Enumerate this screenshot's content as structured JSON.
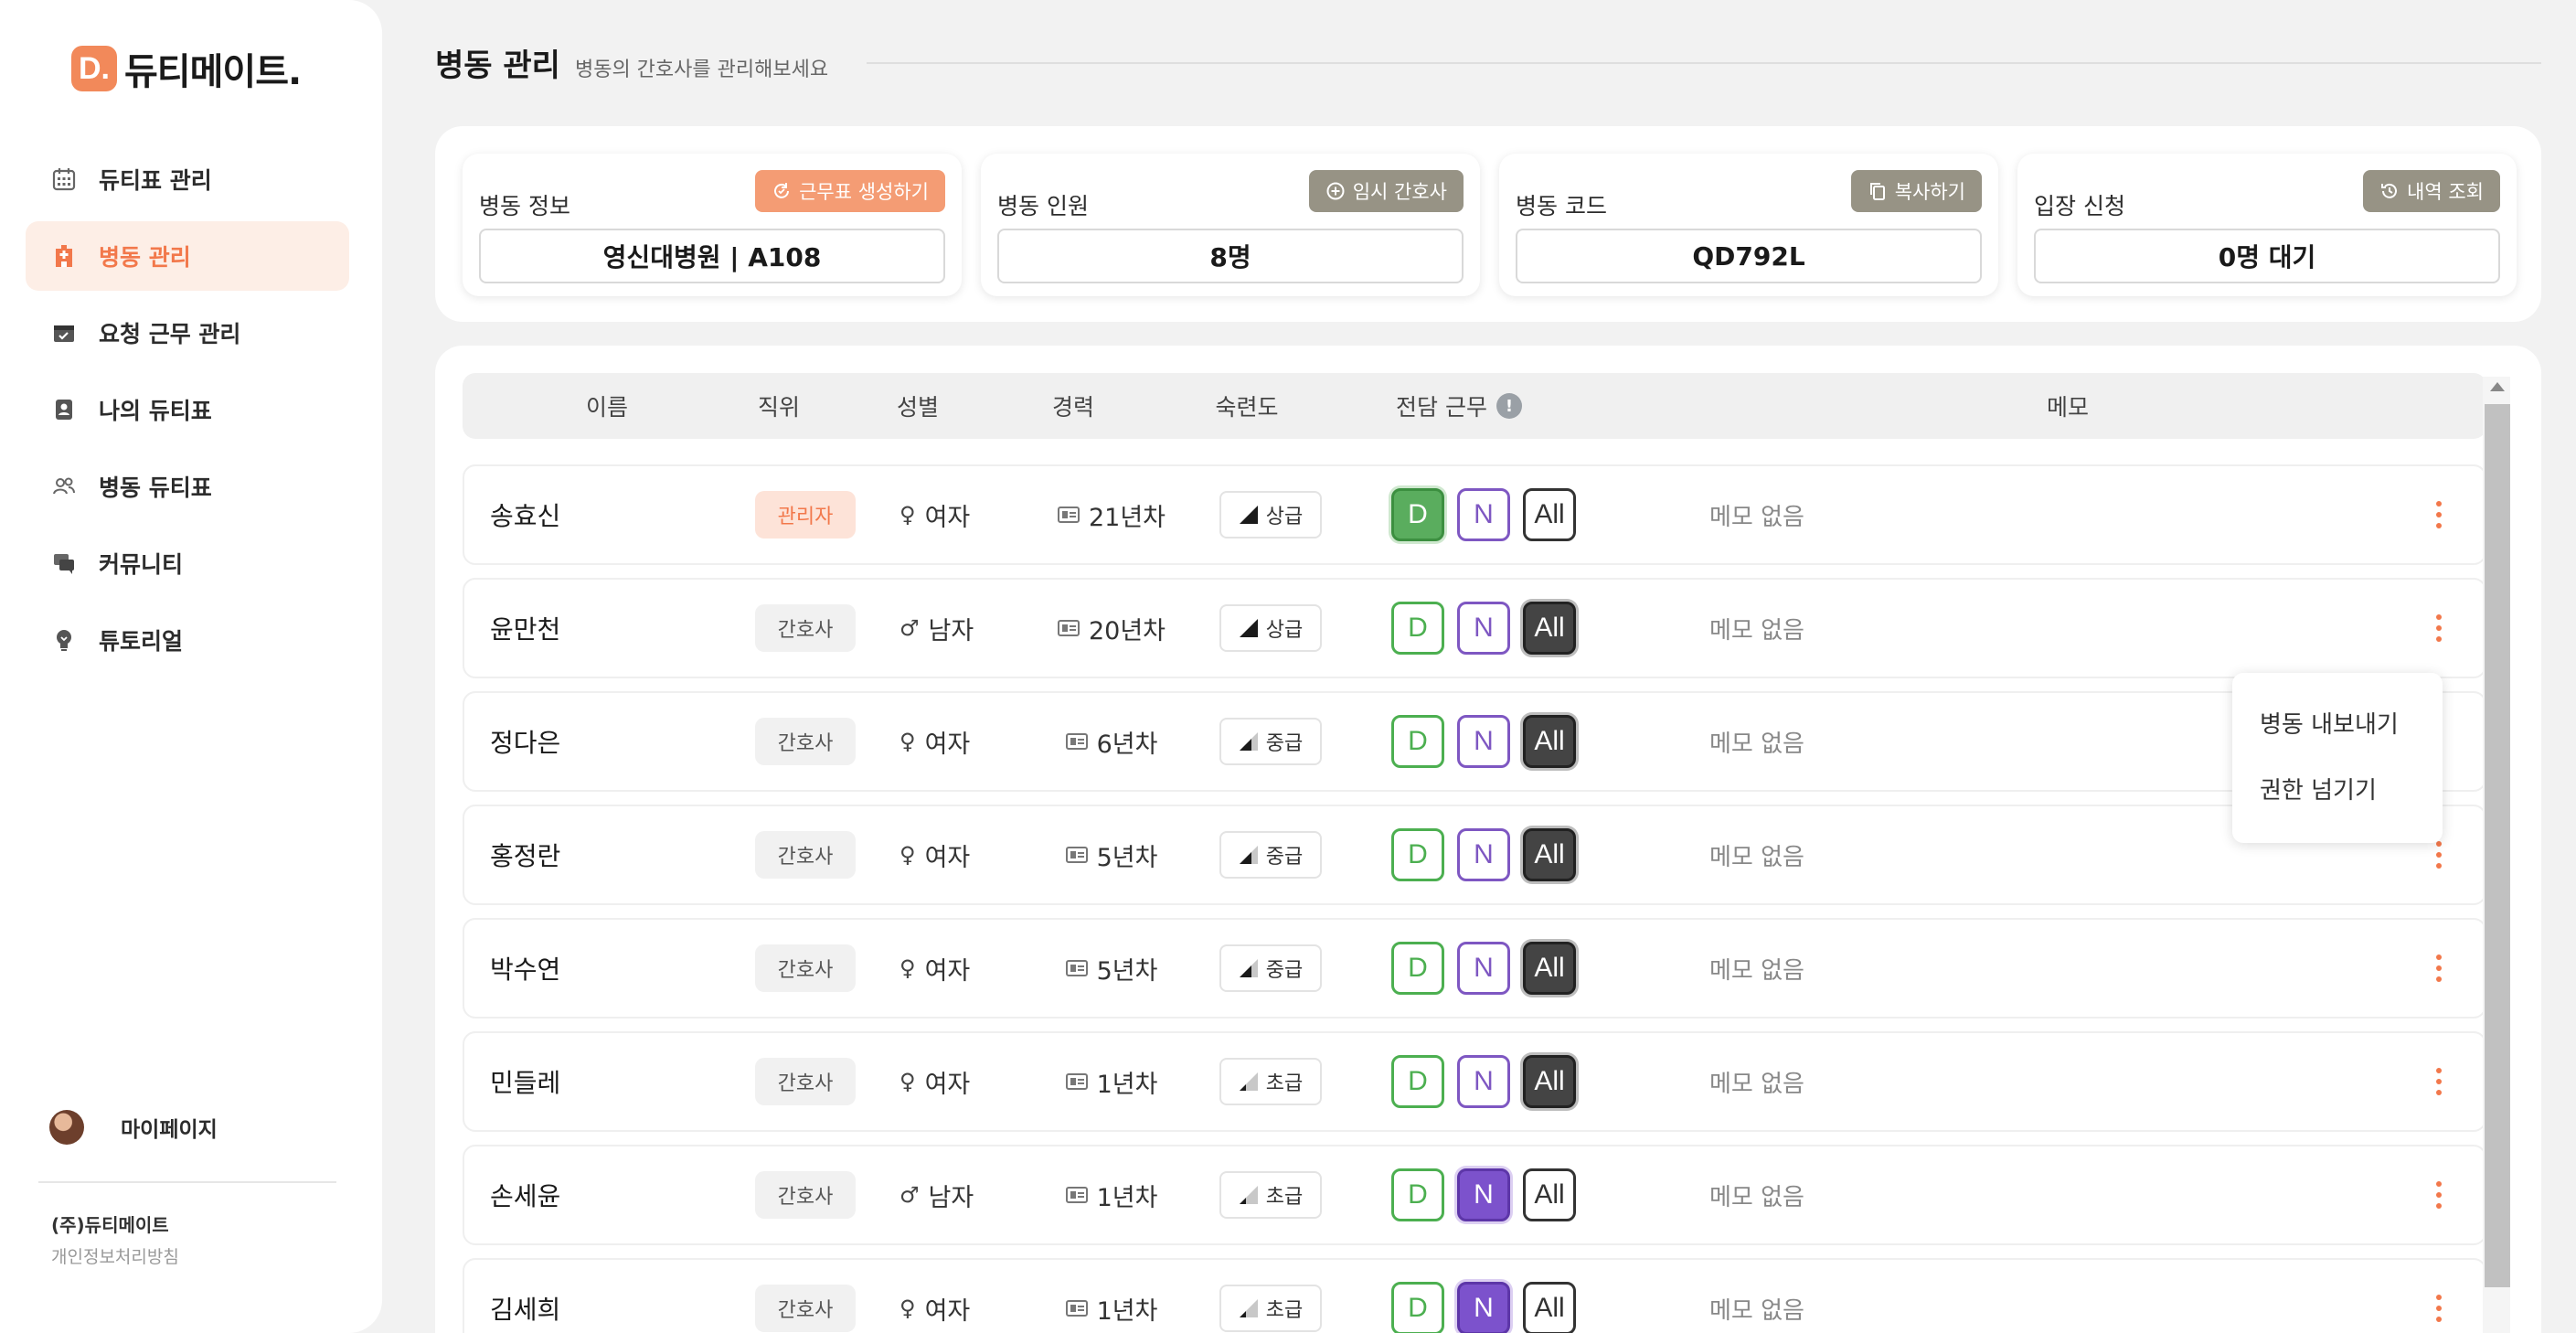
{
  "sidebar": {
    "logo_mark": "D.",
    "logo_text": "듀티메이트.",
    "nav": [
      {
        "label": "듀티표 관리",
        "icon": "calendar-icon",
        "active": false
      },
      {
        "label": "병동 관리",
        "icon": "hospital-icon",
        "active": true
      },
      {
        "label": "요청 근무 관리",
        "icon": "calendar-check-icon",
        "active": false
      },
      {
        "label": "나의 듀티표",
        "icon": "person-badge-icon",
        "active": false
      },
      {
        "label": "병동 듀티표",
        "icon": "people-icon",
        "active": false
      },
      {
        "label": "커뮤니티",
        "icon": "chat-icon",
        "active": false
      },
      {
        "label": "튜토리얼",
        "icon": "lightbulb-icon",
        "active": false
      }
    ],
    "mypage_label": "마이페이지",
    "company": "(주)듀티메이트",
    "privacy": "개인정보처리방침"
  },
  "header": {
    "title": "병동 관리",
    "subtitle": "병동의 간호사를 관리해보세요"
  },
  "info_cards": [
    {
      "title": "병동 정보",
      "button": "근무표 생성하기",
      "button_icon": "refresh-icon",
      "value": "영신대병원 | A108"
    },
    {
      "title": "병동 인원",
      "button": "임시 간호사",
      "button_icon": "plus-circle-icon",
      "value": "8명"
    },
    {
      "title": "병동 코드",
      "button": "복사하기",
      "button_icon": "copy-icon",
      "value": "QD792L"
    },
    {
      "title": "입장 신청",
      "button": "내역 조회",
      "button_icon": "history-icon",
      "value": "0명 대기"
    }
  ],
  "table": {
    "headers": {
      "name": "이름",
      "position": "직위",
      "gender": "성별",
      "career": "경력",
      "skill": "숙련도",
      "duty": "전담 근무",
      "duty_info": "!",
      "memo": "메모"
    },
    "duty_labels": {
      "d": "D",
      "n": "N",
      "all": "All"
    },
    "rows": [
      {
        "name": "송효신",
        "position": "관리자",
        "admin": true,
        "gender": "여자",
        "gender_icon": "♀",
        "career": "21년차",
        "skill": "상급",
        "skill_level": 3,
        "duty": "D",
        "memo": "메모 없음"
      },
      {
        "name": "윤만천",
        "position": "간호사",
        "admin": false,
        "gender": "남자",
        "gender_icon": "♂",
        "career": "20년차",
        "skill": "상급",
        "skill_level": 3,
        "duty": "All",
        "memo": "메모 없음"
      },
      {
        "name": "정다은",
        "position": "간호사",
        "admin": false,
        "gender": "여자",
        "gender_icon": "♀",
        "career": "6년차",
        "skill": "중급",
        "skill_level": 2,
        "duty": "All",
        "memo": "메모 없음"
      },
      {
        "name": "홍정란",
        "position": "간호사",
        "admin": false,
        "gender": "여자",
        "gender_icon": "♀",
        "career": "5년차",
        "skill": "중급",
        "skill_level": 2,
        "duty": "All",
        "memo": "메모 없음"
      },
      {
        "name": "박수연",
        "position": "간호사",
        "admin": false,
        "gender": "여자",
        "gender_icon": "♀",
        "career": "5년차",
        "skill": "중급",
        "skill_level": 2,
        "duty": "All",
        "memo": "메모 없음"
      },
      {
        "name": "민들레",
        "position": "간호사",
        "admin": false,
        "gender": "여자",
        "gender_icon": "♀",
        "career": "1년차",
        "skill": "초급",
        "skill_level": 1,
        "duty": "All",
        "memo": "메모 없음"
      },
      {
        "name": "손세윤",
        "position": "간호사",
        "admin": false,
        "gender": "남자",
        "gender_icon": "♂",
        "career": "1년차",
        "skill": "초급",
        "skill_level": 1,
        "duty": "N",
        "memo": "메모 없음"
      },
      {
        "name": "김세희",
        "position": "간호사",
        "admin": false,
        "gender": "여자",
        "gender_icon": "♀",
        "career": "1년차",
        "skill": "초급",
        "skill_level": 1,
        "duty": "N",
        "memo": "메모 없음"
      }
    ]
  },
  "dropdown": {
    "items": [
      "병동 내보내기",
      "권한 넘기기"
    ]
  },
  "colors": {
    "accent": "#f2784b",
    "day": "#4caf50",
    "night": "#7e57c2",
    "all": "#444444"
  }
}
